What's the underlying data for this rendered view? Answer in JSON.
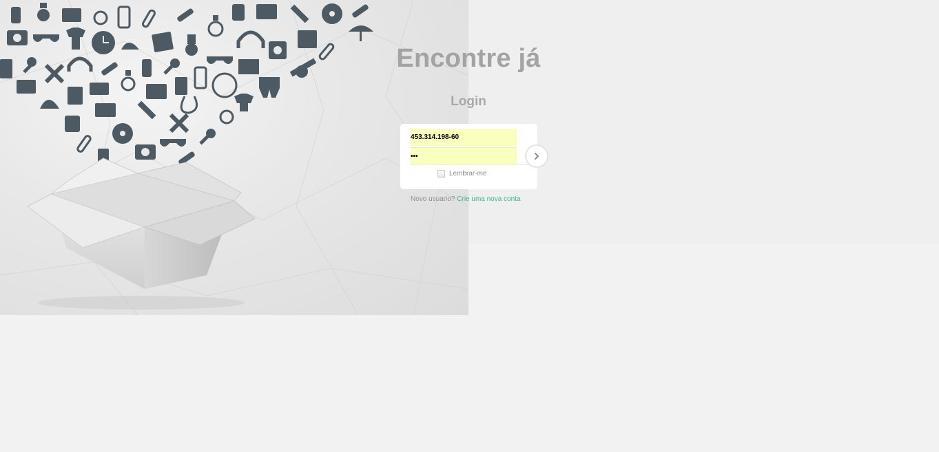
{
  "header": {
    "title": "Encontre já",
    "subtitle": "Login"
  },
  "login_form": {
    "username_value": "453.314.198-60",
    "password_value": "•••",
    "remember_label": "Lembrar-me",
    "remember_checked": false,
    "submit_icon": "chevron-right-icon"
  },
  "signup": {
    "prompt": "Novo usuario?",
    "link_label": "Crie uma nova conta"
  },
  "hero": {
    "image": "open-box-with-icons-illustration",
    "icon_color": "#4e5a63"
  },
  "colors": {
    "background": "#f2f2f2",
    "title": "#a3a3a3",
    "input_autofill": "#fbffbd",
    "link": "#3fb38b"
  }
}
